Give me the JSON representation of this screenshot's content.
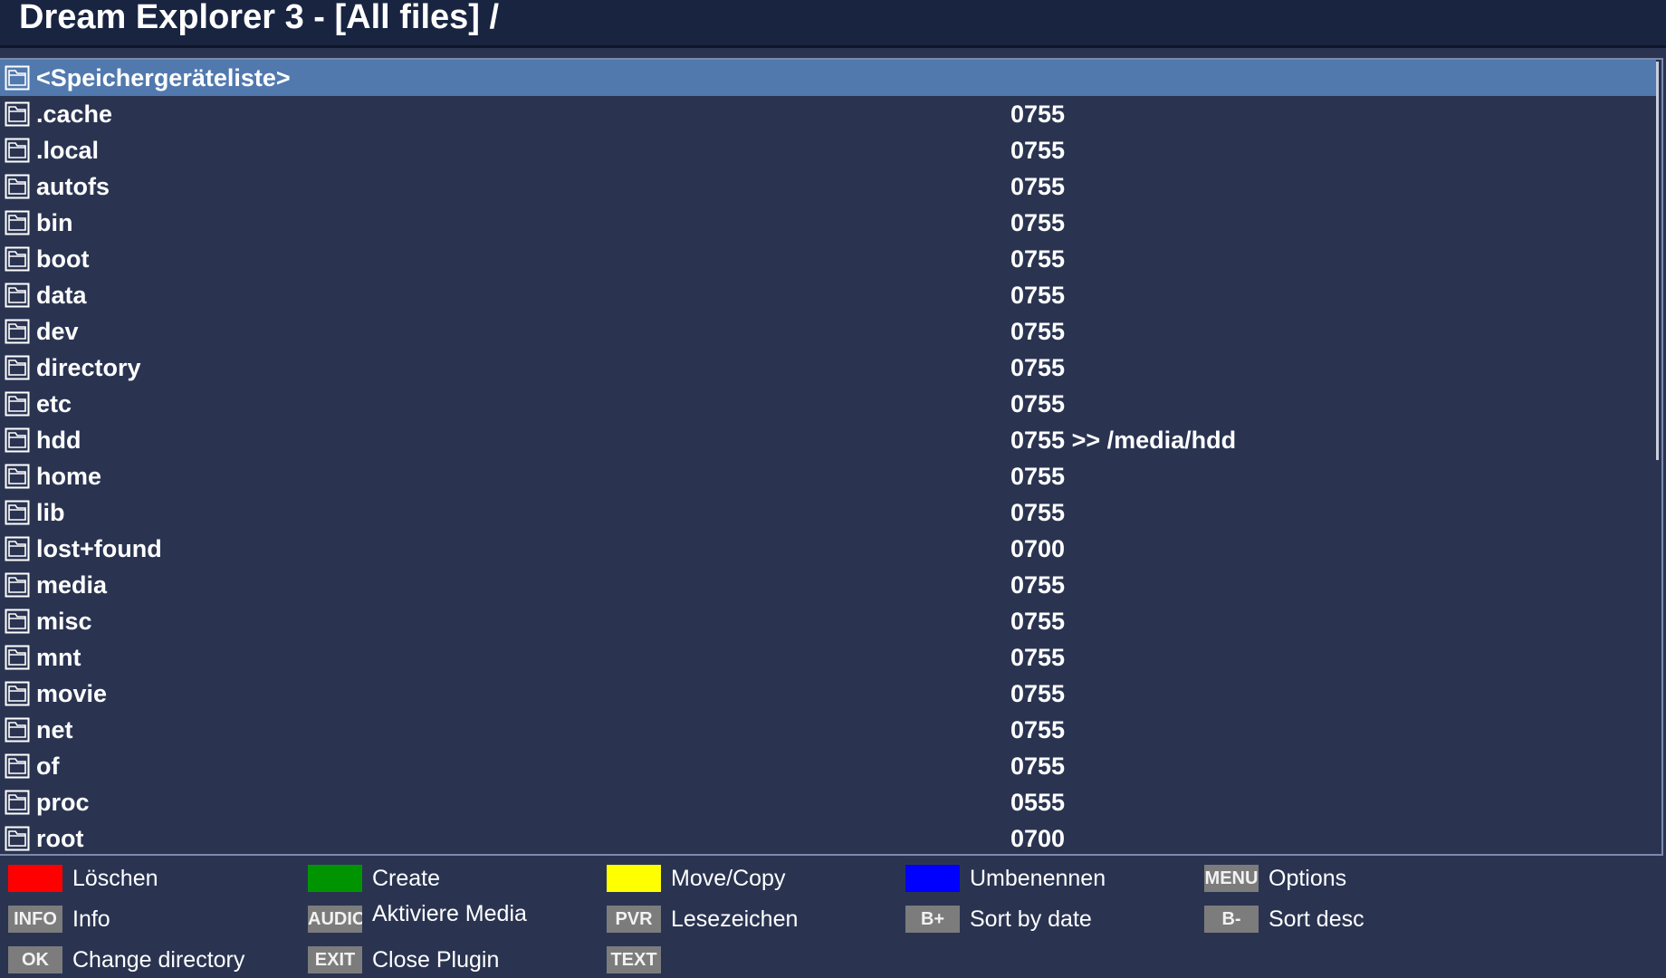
{
  "window": {
    "title": "Dream Explorer 3 - [All files] /"
  },
  "file_list": {
    "rows": [
      {
        "name": "<Speichergeräteliste>",
        "perm": "",
        "selected": true
      },
      {
        "name": ".cache",
        "perm": "0755"
      },
      {
        "name": ".local",
        "perm": "0755"
      },
      {
        "name": "autofs",
        "perm": "0755"
      },
      {
        "name": "bin",
        "perm": "0755"
      },
      {
        "name": "boot",
        "perm": "0755"
      },
      {
        "name": "data",
        "perm": "0755"
      },
      {
        "name": "dev",
        "perm": "0755"
      },
      {
        "name": "directory",
        "perm": "0755"
      },
      {
        "name": "etc",
        "perm": "0755"
      },
      {
        "name": "hdd",
        "perm": "0755 >> /media/hdd"
      },
      {
        "name": "home",
        "perm": "0755"
      },
      {
        "name": "lib",
        "perm": "0755"
      },
      {
        "name": "lost+found",
        "perm": "0700"
      },
      {
        "name": "media",
        "perm": "0755"
      },
      {
        "name": "misc",
        "perm": "0755"
      },
      {
        "name": "mnt",
        "perm": "0755"
      },
      {
        "name": "movie",
        "perm": "0755"
      },
      {
        "name": "net",
        "perm": "0755"
      },
      {
        "name": "of",
        "perm": "0755"
      },
      {
        "name": "proc",
        "perm": "0555"
      },
      {
        "name": "root",
        "perm": "0700"
      }
    ]
  },
  "footer": {
    "red": {
      "label": "Löschen",
      "color": "#ff0000"
    },
    "green": {
      "label": "Create",
      "color": "#009500"
    },
    "yellow": {
      "label": "Move/Copy",
      "color": "#ffff00"
    },
    "blue": {
      "label": "Umbenennen",
      "color": "#0000ff"
    },
    "menu": {
      "key": "MENU",
      "label": "Options"
    },
    "info": {
      "key": "INFO",
      "label": "Info"
    },
    "audio": {
      "key": "AUDIO",
      "label": "Aktiviere Media Filter"
    },
    "pvr": {
      "key": "PVR",
      "label": "Lesezeichen"
    },
    "bplus": {
      "key": "B+",
      "label": "Sort by date"
    },
    "bminus": {
      "key": "B-",
      "label": "Sort desc"
    },
    "ok": {
      "key": "OK",
      "label": "Change directory"
    },
    "exit": {
      "key": "EXIT",
      "label": "Close Plugin"
    },
    "text": {
      "key": "TEXT",
      "label": ""
    }
  },
  "icons": {
    "row_icon": "folder-icon",
    "list_bg": "#2a3451",
    "selection": "#5179ae"
  }
}
